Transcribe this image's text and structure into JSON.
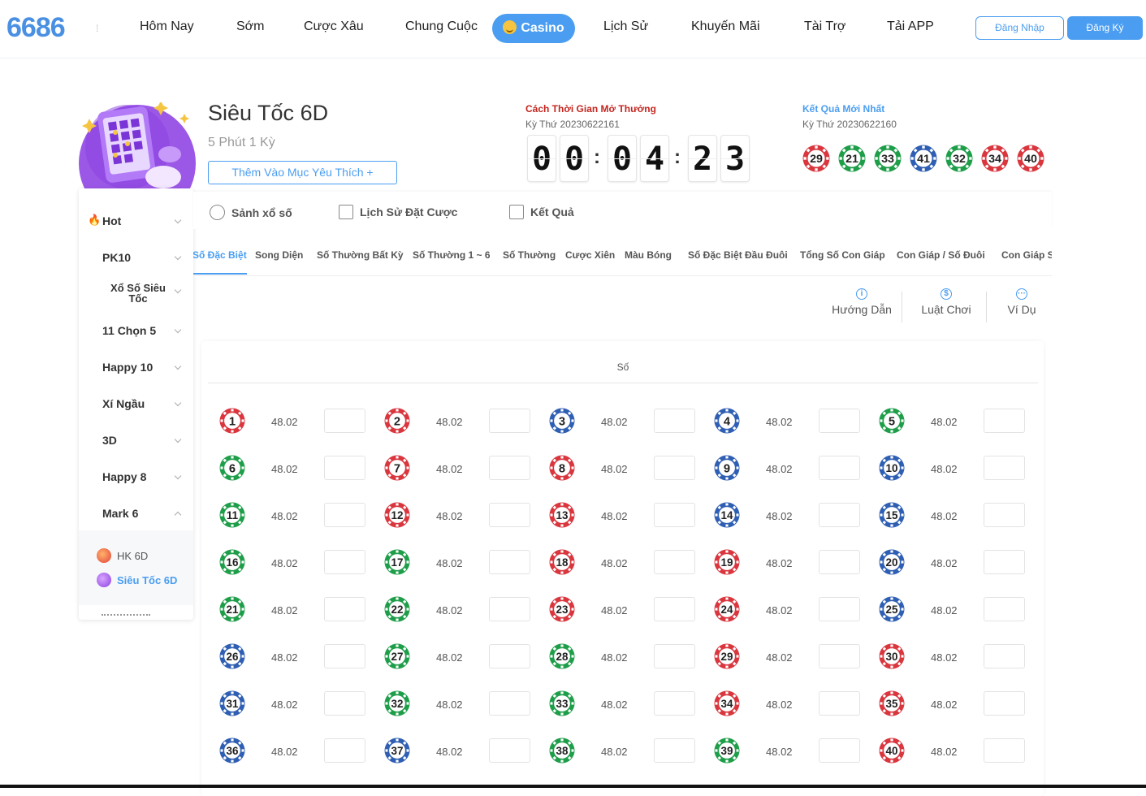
{
  "header": {
    "logo": "6686",
    "nav": [
      "Hôm Nay",
      "Sớm",
      "Cược Xâu",
      "Chung Cuộc",
      "Casino",
      "Lịch Sử",
      "Khuyến Mãi",
      "Tài Trợ",
      "Tải APP"
    ],
    "login": "Đăng Nhập",
    "register": "Đăng Ký"
  },
  "game": {
    "title": "Siêu Tốc 6D",
    "subtitle": "5 Phút 1 Kỳ",
    "favorite": "Thêm Vào Mục Yêu Thích +"
  },
  "countdown": {
    "title": "Cách Thời Gian Mở Thưởng",
    "period": "Kỳ Thứ 20230622161",
    "digits": [
      "0",
      "0",
      "0",
      "4",
      "2",
      "3"
    ]
  },
  "latest": {
    "title": "Kết Quả Mới Nhất",
    "period": "Kỳ Thứ 20230622160",
    "balls": [
      {
        "n": "29",
        "c": "red"
      },
      {
        "n": "21",
        "c": "green"
      },
      {
        "n": "33",
        "c": "green"
      },
      {
        "n": "41",
        "c": "blue"
      },
      {
        "n": "32",
        "c": "green"
      },
      {
        "n": "34",
        "c": "red"
      },
      {
        "n": "40",
        "c": "red"
      }
    ]
  },
  "sidebar": {
    "items": [
      "Hot",
      "PK10",
      "Xổ Số Siêu Tốc",
      "11 Chọn 5",
      "Happy 10",
      "Xí Ngầu",
      "3D",
      "Happy 8",
      "Mark 6"
    ],
    "sub": [
      "HK 6D",
      "Siêu Tốc 6D"
    ]
  },
  "tabs": {
    "main": [
      "Sảnh xổ số",
      "Lịch Sử Đặt Cược",
      "Kết Quả"
    ],
    "sub": [
      "Số Đặc Biệt",
      "Song Diện",
      "Số Thường Bất Kỳ",
      "Số Thường 1 ~ 6",
      "Số Thường",
      "Cược Xiên",
      "Màu Bóng",
      "Số Đặc Biệt Đầu Đuôi",
      "Tổng Số Con Giáp",
      "Con Giáp / Số Đuôi",
      "Con Giáp S"
    ]
  },
  "help": [
    "Hướng Dẫn",
    "Luật Chơi",
    "Ví Dụ"
  ],
  "bet": {
    "header": "Số",
    "odds": "48.02",
    "numbers": [
      {
        "n": "1",
        "c": "red"
      },
      {
        "n": "2",
        "c": "red"
      },
      {
        "n": "3",
        "c": "blue"
      },
      {
        "n": "4",
        "c": "blue"
      },
      {
        "n": "5",
        "c": "green"
      },
      {
        "n": "6",
        "c": "green"
      },
      {
        "n": "7",
        "c": "red"
      },
      {
        "n": "8",
        "c": "red"
      },
      {
        "n": "9",
        "c": "blue"
      },
      {
        "n": "10",
        "c": "blue"
      },
      {
        "n": "11",
        "c": "green"
      },
      {
        "n": "12",
        "c": "red"
      },
      {
        "n": "13",
        "c": "red"
      },
      {
        "n": "14",
        "c": "blue"
      },
      {
        "n": "15",
        "c": "blue"
      },
      {
        "n": "16",
        "c": "green"
      },
      {
        "n": "17",
        "c": "green"
      },
      {
        "n": "18",
        "c": "red"
      },
      {
        "n": "19",
        "c": "red"
      },
      {
        "n": "20",
        "c": "blue"
      },
      {
        "n": "21",
        "c": "green"
      },
      {
        "n": "22",
        "c": "green"
      },
      {
        "n": "23",
        "c": "red"
      },
      {
        "n": "24",
        "c": "red"
      },
      {
        "n": "25",
        "c": "blue"
      },
      {
        "n": "26",
        "c": "blue"
      },
      {
        "n": "27",
        "c": "green"
      },
      {
        "n": "28",
        "c": "green"
      },
      {
        "n": "29",
        "c": "red"
      },
      {
        "n": "30",
        "c": "red"
      },
      {
        "n": "31",
        "c": "blue"
      },
      {
        "n": "32",
        "c": "green"
      },
      {
        "n": "33",
        "c": "green"
      },
      {
        "n": "34",
        "c": "red"
      },
      {
        "n": "35",
        "c": "red"
      },
      {
        "n": "36",
        "c": "blue"
      },
      {
        "n": "37",
        "c": "blue"
      },
      {
        "n": "38",
        "c": "green"
      },
      {
        "n": "39",
        "c": "green"
      },
      {
        "n": "40",
        "c": "red"
      }
    ]
  },
  "colors": {
    "accent": "#4a9df0",
    "red": "#d9363e",
    "green": "#1f9e4a",
    "blue": "#2f5fb3",
    "countdownTitle": "#c3261f"
  }
}
